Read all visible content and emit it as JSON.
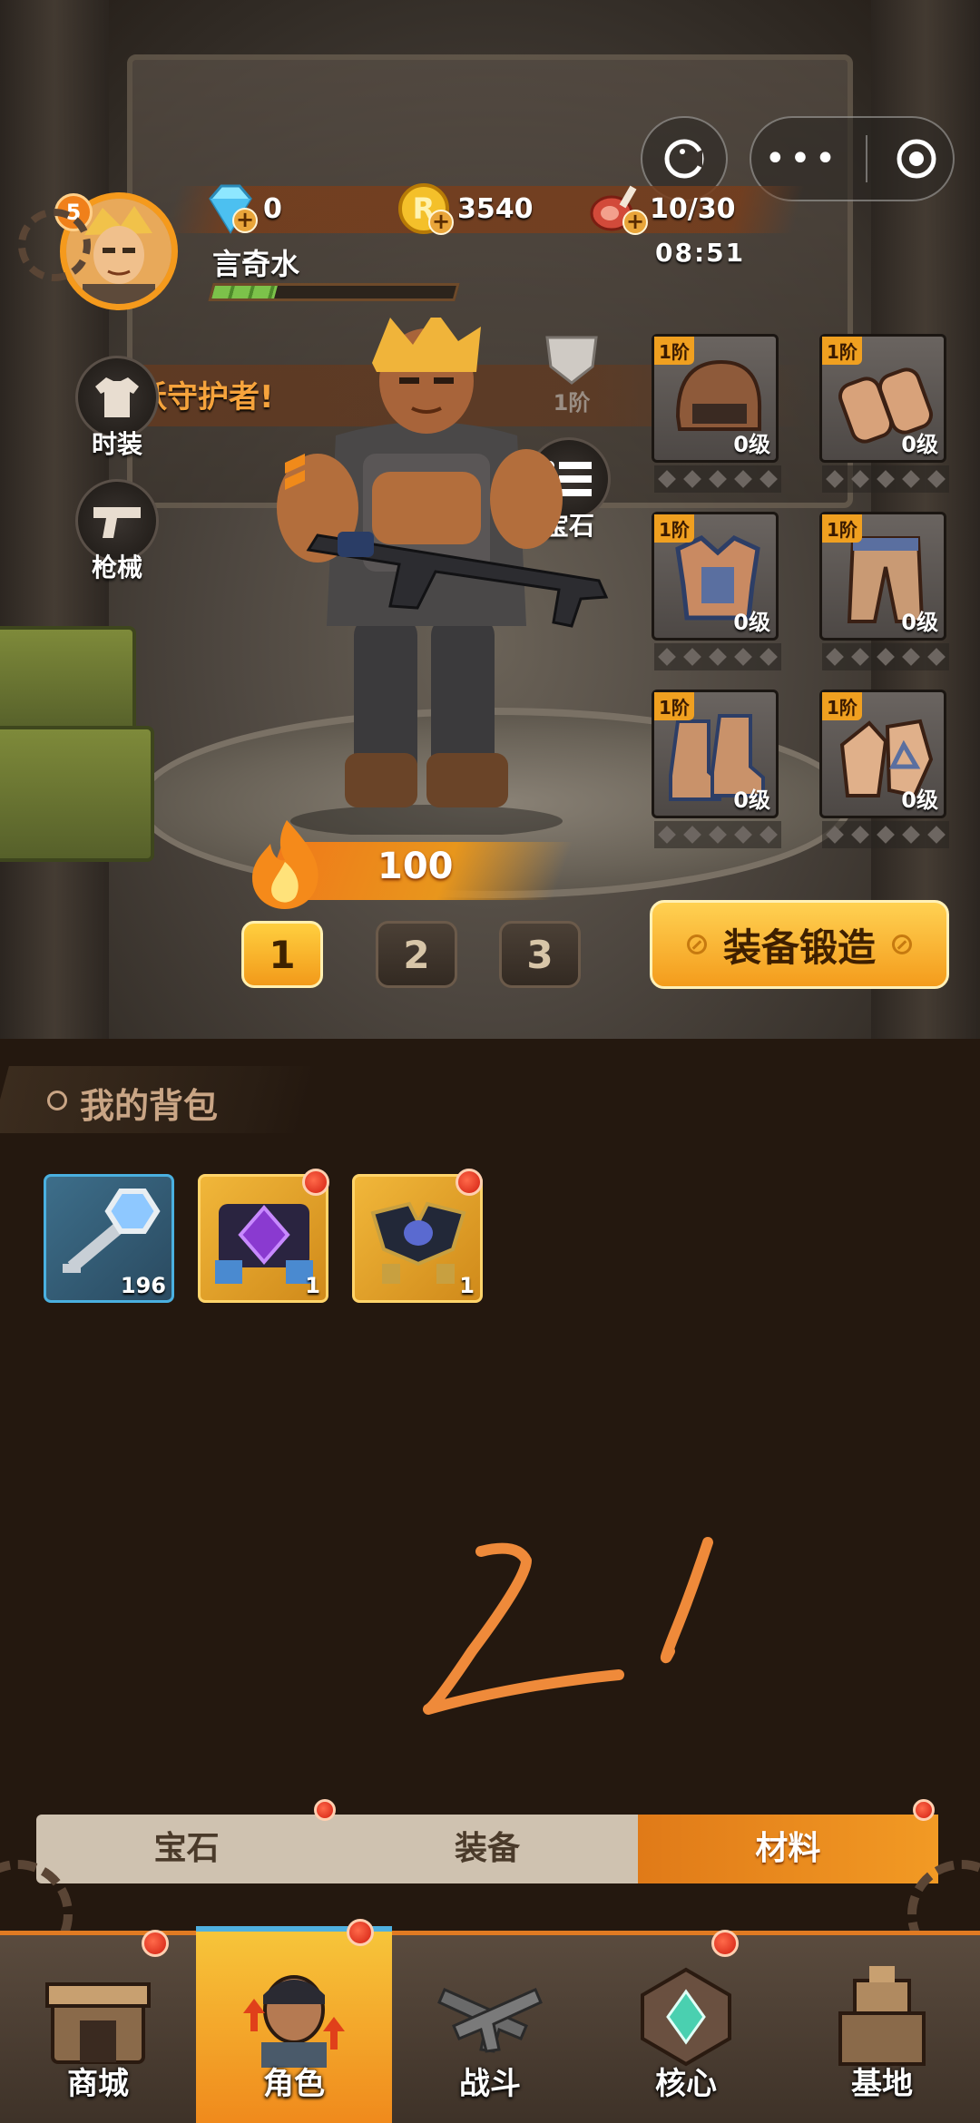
{
  "header": {
    "player_name": "言奇水",
    "player_level": "5",
    "xp_fraction": 0.26,
    "clock": "08:51",
    "resources": [
      {
        "name": "diamond",
        "icon": "diamond-icon",
        "value": "0"
      },
      {
        "name": "gold",
        "icon": "gold-coin-icon",
        "value": "3540"
      },
      {
        "name": "stamina",
        "icon": "meat-icon",
        "value": "10/30"
      }
    ]
  },
  "banner": {
    "text": "跃守护者!"
  },
  "side_buttons": {
    "fashion": "时装",
    "guns": "枪械",
    "gems": "宝石"
  },
  "badge_tier": "1阶",
  "equipment": [
    {
      "slot": "helmet",
      "tier": "1阶",
      "level": "0级"
    },
    {
      "slot": "bracers",
      "tier": "1阶",
      "level": "0级"
    },
    {
      "slot": "armor",
      "tier": "1阶",
      "level": "0级"
    },
    {
      "slot": "pants",
      "tier": "1阶",
      "level": "0级"
    },
    {
      "slot": "boots",
      "tier": "1阶",
      "level": "0级"
    },
    {
      "slot": "gloves",
      "tier": "1阶",
      "level": "0级"
    }
  ],
  "power": "100",
  "presets": [
    "1",
    "2",
    "3"
  ],
  "forge_button": "装备锻造",
  "backpack": {
    "title": "我的背包",
    "items": [
      {
        "name": "key",
        "count": "196"
      },
      {
        "name": "purple-crystal",
        "count": "1"
      },
      {
        "name": "gold-drone",
        "count": "1"
      }
    ]
  },
  "handwriting": "21",
  "category_tabs": [
    "宝石",
    "装备",
    "材料"
  ],
  "active_category": "材料",
  "nav": [
    "商城",
    "角色",
    "战斗",
    "核心",
    "基地"
  ],
  "active_nav": "角色",
  "colors": {
    "accent": "#f29a1a",
    "panel": "#24180f",
    "nav_bg": "#4a3c30"
  }
}
